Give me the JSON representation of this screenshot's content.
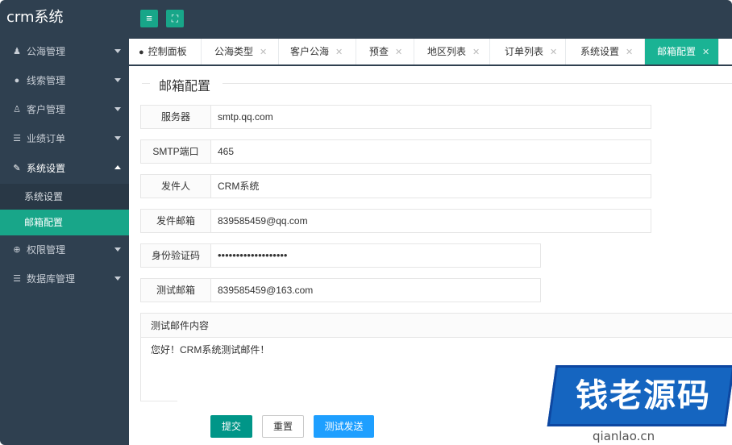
{
  "app": {
    "brand": "crm系统"
  },
  "toolbar": {
    "menu_icon": "≡",
    "fullscreen_icon": "⛶"
  },
  "sidebar": {
    "items": [
      {
        "label": "公海管理",
        "icon": "person-icon"
      },
      {
        "label": "线索管理",
        "icon": "globe-icon"
      },
      {
        "label": "客户管理",
        "icon": "user-icon"
      },
      {
        "label": "业绩订单",
        "icon": "database-icon"
      },
      {
        "label": "系统设置",
        "icon": "wrench-icon"
      },
      {
        "label": "权限管理",
        "icon": "crosshair-icon"
      },
      {
        "label": "数据库管理",
        "icon": "database-icon"
      }
    ],
    "sub_items": [
      {
        "label": "系统设置"
      },
      {
        "label": "邮箱配置"
      }
    ]
  },
  "tabs": [
    {
      "label": "控制面板"
    },
    {
      "label": "公海类型"
    },
    {
      "label": "客户公海"
    },
    {
      "label": "预查"
    },
    {
      "label": "地区列表"
    },
    {
      "label": "订单列表"
    },
    {
      "label": "系统设置"
    },
    {
      "label": "邮箱配置"
    }
  ],
  "form": {
    "title": "邮箱配置",
    "fields": [
      {
        "label": "服务器",
        "value": "smtp.qq.com"
      },
      {
        "label": "SMTP端口",
        "value": "465"
      },
      {
        "label": "发件人",
        "value": "CRM系统"
      },
      {
        "label": "发件邮箱",
        "value": "839585459@qq.com"
      },
      {
        "label": "身份验证码",
        "value": "•••••••••••••••••••"
      },
      {
        "label": "测试邮箱",
        "value": "839585459@163.com"
      }
    ],
    "content_label": "测试邮件内容",
    "content_value": "您好！CRM系统测试邮件！",
    "submit_label": "提交",
    "reset_label": "重置",
    "test_label": "测试发送"
  },
  "watermark": {
    "text": "钱老源码",
    "url": "qianlao.cn"
  },
  "colors": {
    "sidebar_bg": "#2f4050",
    "accent": "#1ab394",
    "primary_btn": "#009688",
    "test_btn": "#1e9fff"
  }
}
